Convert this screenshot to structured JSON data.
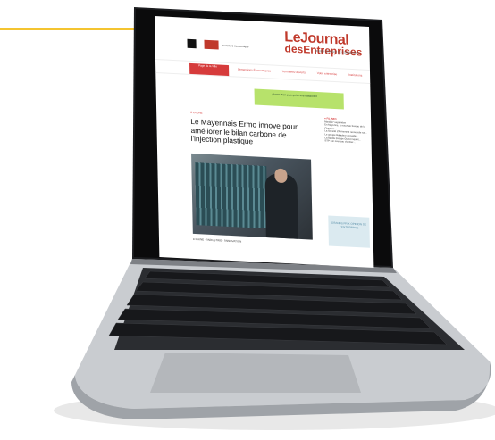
{
  "site": {
    "title_line1": "LeJournal",
    "title_line2": "desEntreprises",
    "small_label": "ouverture économique",
    "top_icons": "JOUER GRATUIT    SE CONNECTER",
    "nav_red": "Page de la Ville",
    "nav_items": [
      "Dimensions Économiques",
      "Territoires Ouverts",
      "Votre entreprise",
      "Institutions"
    ],
    "ad_text": "pluxee Bien plus qu'un titre restaurant",
    "headline_kicker": "À LA UNE",
    "headline": "Le Mayennais Ermo innove pour améliorer le bilan carbone de l'injection plastique",
    "caption": "● MAINE · l'INDUSTRIE · l'INNOVATION",
    "sidebar_title": "● FIL INFO",
    "sidebar_date": "Mardi 17 septembre",
    "sidebar_items": [
      "En Mayenne, le nouveau bureau de la Chambre…",
      "La Société d'Armement renouvelle sa…",
      "Le groupe Balladeur accueille…",
      "La famille Groupe Guinot rejoint…",
      "BTP : un nouveau chantier…"
    ],
    "promo_text": "GRANDS PRIX OPINION DE L'ENTREPRISE"
  },
  "colors": {
    "accent_line": "#f4c430",
    "brand_red": "#c0392b"
  }
}
